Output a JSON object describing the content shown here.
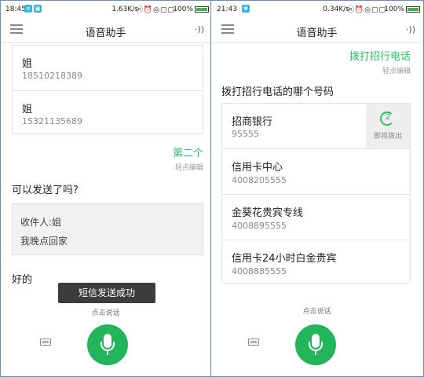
{
  "left": {
    "status": {
      "time": "18:45",
      "speed": "1.63K/s",
      "glyphs": "ⓝ⏰◎▢▢",
      "battery": "100%"
    },
    "appbar": {
      "title": "语音助手",
      "sound_icon": "·))"
    },
    "contacts": [
      {
        "name": "姐",
        "number": "18510218389"
      },
      {
        "name": "姐",
        "number": "15321135689"
      }
    ],
    "selection": {
      "text": "第二个",
      "edit_hint": "轻点编辑"
    },
    "question": "可以发送了吗?",
    "sms": {
      "recipient": "收件人:姐",
      "body": "我晚点回家"
    },
    "reply": "好的",
    "toast": "短信发送成功",
    "speak_hint": "点击说话"
  },
  "right": {
    "status": {
      "time": "21:43",
      "speed": "0.34K/s",
      "glyphs": "ⓝ⏰◎▢▢",
      "battery": "100%"
    },
    "appbar": {
      "title": "语音助手",
      "sound_icon": "·))"
    },
    "command": {
      "text": "拨打招行电话",
      "edit_hint": "轻点编辑"
    },
    "question": "拨打招行电话的哪个号码",
    "numbers": [
      {
        "name": "招商银行",
        "number": "95555"
      },
      {
        "name": "信用卡中心",
        "number": "4008205555"
      },
      {
        "name": "金葵花贵宾专线",
        "number": "4008895555"
      },
      {
        "name": "信用卡24小时白金贵宾",
        "number": "4008885555"
      }
    ],
    "countdown": {
      "value": "2",
      "label": "即将拨出"
    },
    "speak_hint": "点击说话"
  },
  "colors": {
    "accent_green": "#2bbf62",
    "mic_green": "#24b45a",
    "toast_bg": "#3c3c3c"
  }
}
